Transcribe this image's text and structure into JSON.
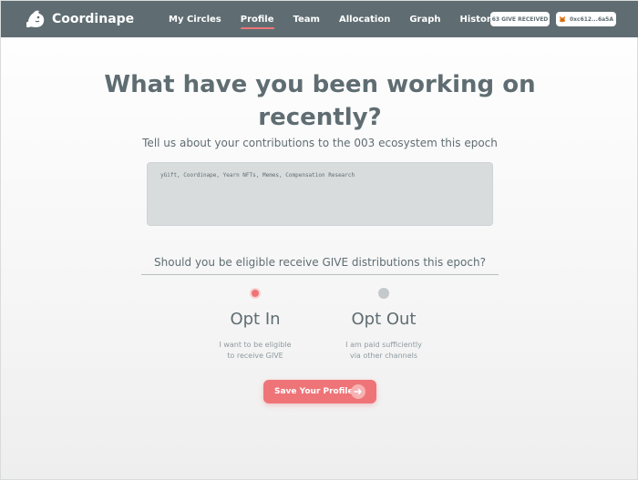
{
  "app": {
    "name": "Coordinape",
    "logo_icon": "coordinape-ape-icon"
  },
  "nav": {
    "items": [
      {
        "label": "My Circles"
      },
      {
        "label": "Profile",
        "active": true
      },
      {
        "label": "Team"
      },
      {
        "label": "Allocation"
      },
      {
        "label": "Graph"
      },
      {
        "label": "History"
      }
    ]
  },
  "header": {
    "give_received": "63 GIVE RECEIVED",
    "wallet_label": "0xc612...6a5A",
    "wallet_icon": "metamask-fox-icon"
  },
  "main": {
    "headline_line1": "What have you been working on",
    "headline_line2": "recently?",
    "subline": "Tell us about your contributions to the 003 ecosystem this epoch",
    "contributions_value": "yGift, Coordinape, Yearn NFTs, Memes, Compensation Research",
    "question": "Should you be eligible receive GIVE distributions this epoch?",
    "options": [
      {
        "title": "Opt In",
        "desc_line1": "I want to be eligible",
        "desc_line2": "to receive GIVE",
        "selected": true
      },
      {
        "title": "Opt Out",
        "desc_line1": "I am paid sufficiently",
        "desc_line2": "via other channels",
        "selected": false
      }
    ],
    "save_label": "Save Your Profile",
    "save_icon": "arrow-right-icon"
  },
  "colors": {
    "header_bg": "#5f6d72",
    "accent": "#ee7478",
    "text": "#5f6d72",
    "input_bg": "#d8dcdd"
  }
}
